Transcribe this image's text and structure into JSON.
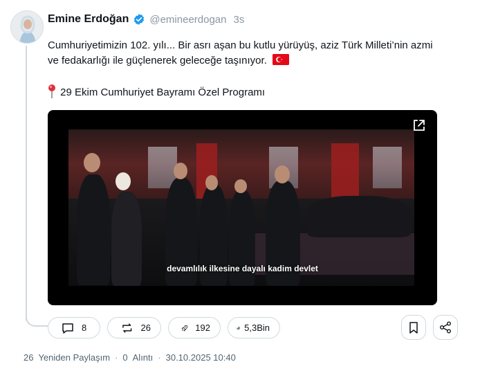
{
  "author": {
    "name": "Emine Erdoğan",
    "handle": "@emineerdogan",
    "time": "3s",
    "verified_color": "#1d9bf0"
  },
  "post": {
    "line1": "Cumhuriyetimizin 102. yılı... Bir asrı aşan bu kutlu yürüyüş, aziz Türk Milleti’nin azmi",
    "line2": "ve fedakarlığı ile güçlenerek geleceğe taşınıyor.",
    "flag_icon": "turkey-flag-icon",
    "line3": "29 Ekim Cumhuriyet Bayramı Özel Programı",
    "pin_icon": "round-pushpin-icon"
  },
  "video": {
    "subtitle": "devamlılık ilkesine dayalı kadim devlet"
  },
  "actions": {
    "replies": "8",
    "reposts": "26",
    "boosts": "192",
    "views": "5,3Bin"
  },
  "footer": {
    "repost_count": "26",
    "repost_label": "Yeniden Paylaşım",
    "quote_count": "0",
    "quote_label": "Alıntı",
    "sep": "·",
    "datetime": "30.10.2025 10:40"
  }
}
